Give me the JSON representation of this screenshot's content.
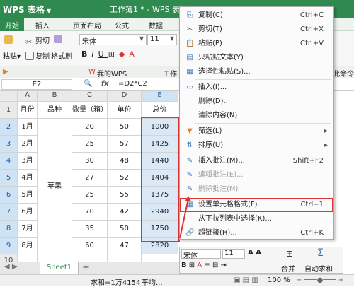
{
  "app": {
    "logo": "WPS 表格",
    "doc_title": "工作簿1 * - WPS 表格"
  },
  "menu_tabs": [
    "开始",
    "插入",
    "页面布局",
    "公式",
    "数据"
  ],
  "ribbon": {
    "cut": "剪切",
    "copy": "复制",
    "format_painter": "格式刷",
    "paste": "粘贴",
    "font": "宋体",
    "size": "11"
  },
  "doc_tabs": {
    "mywps": "我的WPS",
    "workbook": "工作",
    "cmd": "此命令"
  },
  "formula_bar": {
    "name": "E2",
    "fx": "fx",
    "formula": "=D2*C2"
  },
  "columns": [
    "A",
    "B",
    "C",
    "D",
    "E"
  ],
  "headers": [
    "月份",
    "品种",
    "数量（箱）",
    "单价",
    "总价"
  ],
  "rows": [
    {
      "month": "1月",
      "qty": "20",
      "price": "50",
      "total": "1000"
    },
    {
      "month": "2月",
      "qty": "25",
      "price": "57",
      "total": "1425"
    },
    {
      "month": "3月",
      "qty": "30",
      "price": "48",
      "total": "1440"
    },
    {
      "month": "4月",
      "qty": "27",
      "price": "52",
      "total": "1404"
    },
    {
      "month": "5月",
      "qty": "25",
      "price": "55",
      "total": "1375"
    },
    {
      "month": "6月",
      "qty": "70",
      "price": "42",
      "total": "2940"
    },
    {
      "month": "7月",
      "qty": "35",
      "price": "50",
      "total": "1750"
    },
    {
      "month": "8月",
      "qty": "60",
      "price": "47",
      "total": "2820"
    }
  ],
  "variety": "苹果",
  "row_numbers": [
    "1",
    "2",
    "3",
    "4",
    "5",
    "6",
    "7",
    "8",
    "9",
    "10"
  ],
  "context_menu": [
    {
      "label": "复制(C)",
      "shortcut": "Ctrl+C",
      "icon": "copy-icon",
      "glyph": "⎘"
    },
    {
      "label": "剪切(T)",
      "shortcut": "Ctrl+X",
      "icon": "scissors-icon",
      "glyph": "✂"
    },
    {
      "label": "粘贴(P)",
      "shortcut": "Ctrl+V",
      "icon": "paste-icon",
      "glyph": "📋"
    },
    {
      "label": "只粘贴文本(Y)",
      "shortcut": "",
      "icon": "paste-text-icon",
      "glyph": "▤"
    },
    {
      "label": "选择性粘贴(S)...",
      "shortcut": "",
      "icon": "paste-special-icon",
      "glyph": "▦"
    },
    {
      "label": "插入(I)...",
      "shortcut": "",
      "icon": "insert-icon",
      "glyph": "▭"
    },
    {
      "label": "删除(D)...",
      "shortcut": "",
      "icon": "delete-icon",
      "glyph": ""
    },
    {
      "label": "清除内容(N)",
      "shortcut": "",
      "icon": "clear-icon",
      "glyph": ""
    },
    {
      "label": "筛选(L)",
      "shortcut": "",
      "icon": "filter-icon",
      "glyph": "▼"
    },
    {
      "label": "排序(U)",
      "shortcut": "",
      "icon": "sort-icon",
      "glyph": "⇅"
    },
    {
      "label": "插入批注(M)...",
      "shortcut": "Shift+F2",
      "icon": "insert-comment-icon",
      "glyph": "✎"
    },
    {
      "label": "编辑批注(E)...",
      "shortcut": "",
      "icon": "edit-comment-icon",
      "glyph": "✎"
    },
    {
      "label": "删除批注(M)",
      "shortcut": "",
      "icon": "delete-comment-icon",
      "glyph": "✎"
    },
    {
      "label": "设置单元格格式(F)...",
      "shortcut": "Ctrl+1",
      "icon": "format-cells-icon",
      "glyph": "▦"
    },
    {
      "label": "从下拉列表中选择(K)...",
      "shortcut": "",
      "icon": "dropdown-list-icon",
      "glyph": ""
    },
    {
      "label": "超链接(H)...",
      "shortcut": "Ctrl+K",
      "icon": "hyperlink-icon",
      "glyph": "🔗"
    }
  ],
  "mini_toolbar": {
    "font": "宋体",
    "size": "11",
    "merge": "合并",
    "autosum": "自动求和"
  },
  "sheet_tab": "Sheet1",
  "status": {
    "sum": "求和=1万4154",
    "avg": "平均...",
    "zoom": "100 %"
  },
  "colors": {
    "brand": "#2e8a4e",
    "highlight": "#d33333",
    "selection": "#dbe9f6"
  }
}
